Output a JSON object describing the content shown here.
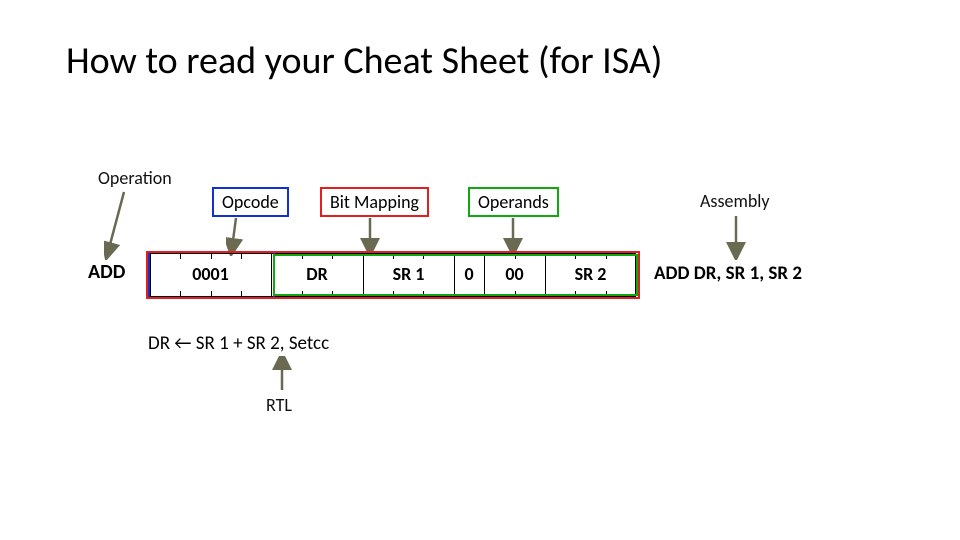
{
  "title": "How to read your Cheat Sheet (for ISA)",
  "labels": {
    "operation": "Operation",
    "opcode": "Opcode",
    "bitmapping": "Bit Mapping",
    "operands": "Operands",
    "assembly": "Assembly",
    "rtl": "RTL"
  },
  "mnemonic": "ADD",
  "fields": {
    "opcode": "0001",
    "dr": "DR",
    "sr1": "SR 1",
    "mode": "0",
    "zeros": "00",
    "sr2": "SR 2"
  },
  "assembly": "ADD DR, SR 1, SR 2",
  "rtl_expr": "DR ← SR 1 + SR 2, Setcc",
  "colors": {
    "opcode_box": "#1030d0",
    "bitmap_box": "#e02020",
    "operand_box": "#10a810",
    "arrow": "#6a6a52"
  }
}
